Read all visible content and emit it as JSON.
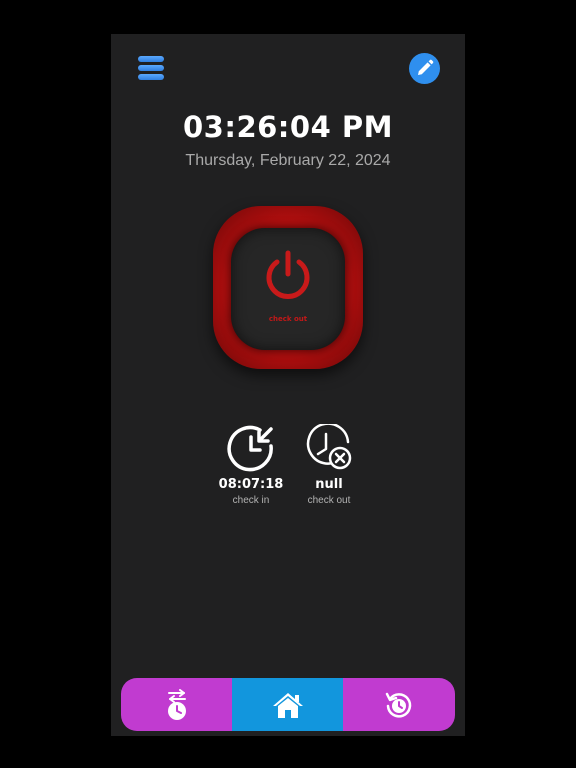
{
  "header": {
    "menu_icon": "menu-icon",
    "edit_icon": "pencil-icon"
  },
  "clock": {
    "time": "03:26:04 PM",
    "date": "Thursday, February 22, 2024"
  },
  "power_button": {
    "icon": "power-icon",
    "label": "check out",
    "color": "#c21818"
  },
  "stats": {
    "check_in": {
      "icon": "check-in-clock-icon",
      "value": "08:07:18",
      "label": "check in"
    },
    "check_out": {
      "icon": "check-out-clock-icon",
      "value": "null",
      "label": "check out"
    }
  },
  "bottom_nav": {
    "items": [
      {
        "icon": "swap-clock-icon",
        "active": false
      },
      {
        "icon": "home-icon",
        "active": true
      },
      {
        "icon": "history-icon",
        "active": false
      }
    ],
    "bar_color": "#c13bd0",
    "active_color": "#1296dd"
  }
}
